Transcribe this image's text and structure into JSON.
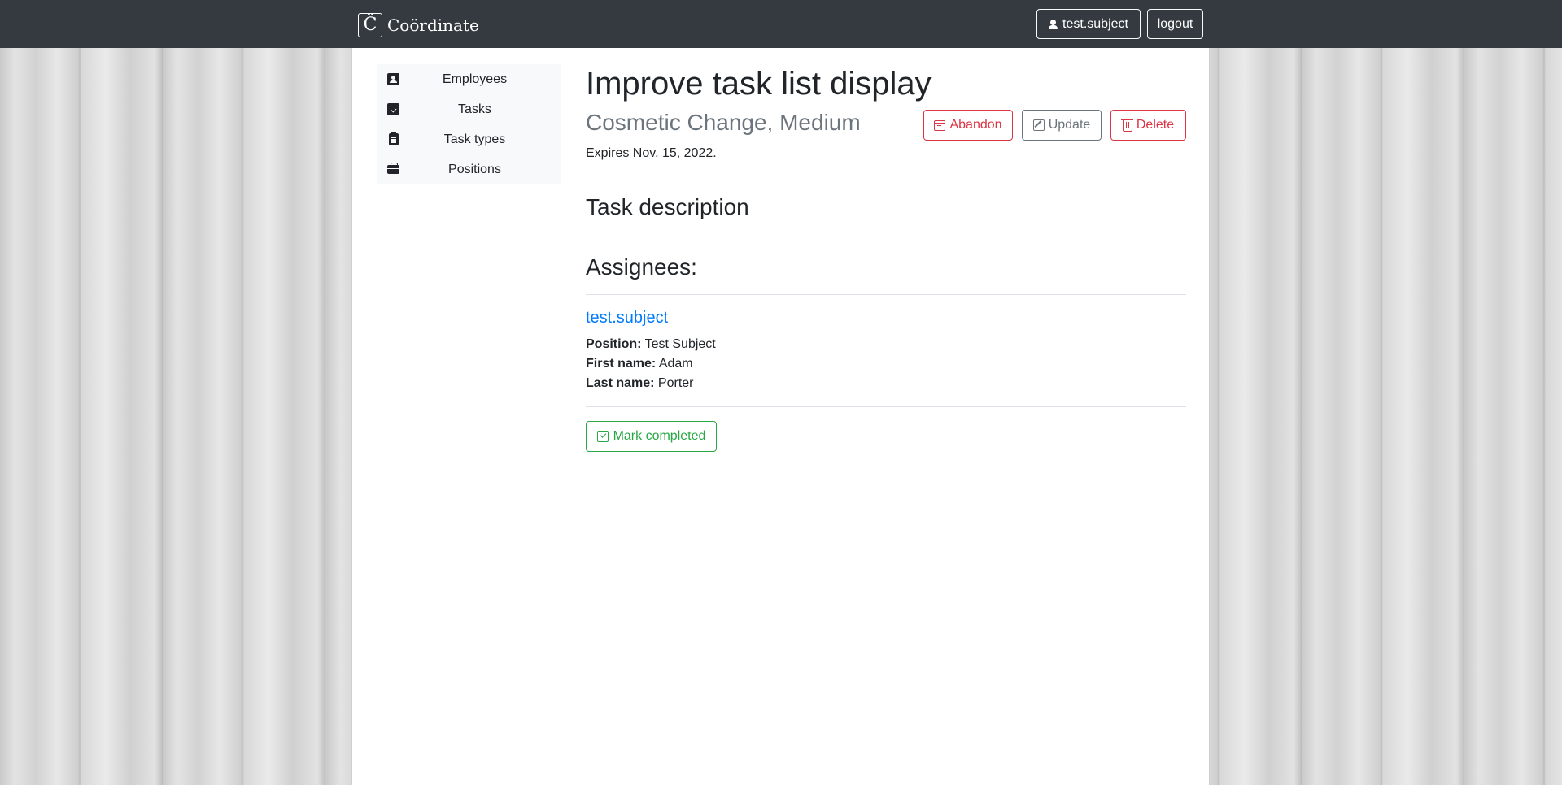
{
  "navbar": {
    "brand_logo": "C̈",
    "brand_name": "Coördinate",
    "user_label": "test.subject",
    "logout_label": "logout"
  },
  "sidebar": {
    "items": [
      {
        "label": "Employees",
        "icon": "person-badge-icon"
      },
      {
        "label": "Tasks",
        "icon": "calendar-check-icon"
      },
      {
        "label": "Task types",
        "icon": "clipboard-icon"
      },
      {
        "label": "Positions",
        "icon": "briefcase-icon"
      }
    ]
  },
  "task": {
    "title": "Improve task list display",
    "subtitle": "Cosmetic Change, Medium",
    "expires": "Expires Nov. 15, 2022.",
    "description_heading": "Task description",
    "assignees_heading": "Assignees:"
  },
  "actions": {
    "abandon_label": "Abandon",
    "update_label": "Update",
    "delete_label": "Delete",
    "complete_label": "Mark completed"
  },
  "assignee": {
    "username": "test.subject",
    "position_label": "Position:",
    "position_value": "Test Subject",
    "first_name_label": "First name:",
    "first_name_value": "Adam",
    "last_name_label": "Last name:",
    "last_name_value": "Porter"
  },
  "colors": {
    "navbar": "#343a40",
    "danger": "#dc3545",
    "secondary": "#6c757d",
    "success": "#28a745",
    "link": "#007bff"
  }
}
